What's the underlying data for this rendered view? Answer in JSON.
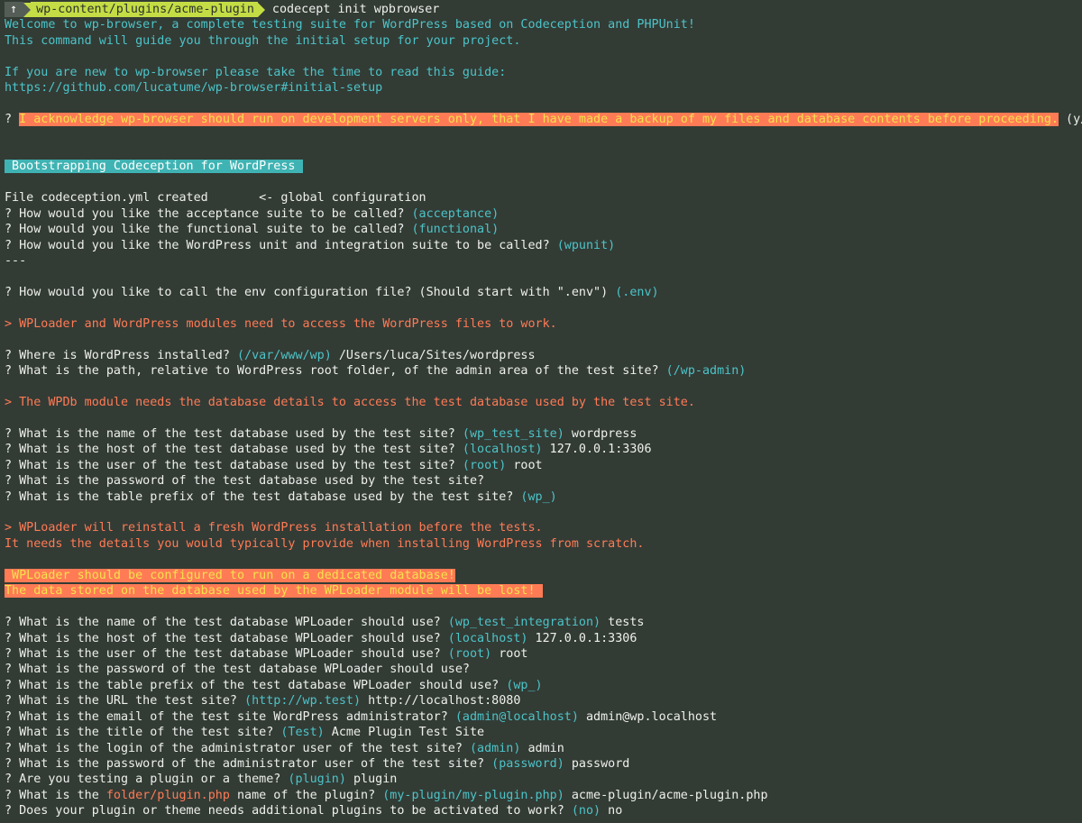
{
  "prompt": {
    "icon": "↑",
    "icon_name": "arrow-up-icon",
    "path": "wp-content/plugins/acme-plugin",
    "command": "codecept init wpbrowser"
  },
  "colors": {
    "background": "#333b35",
    "text": "#eef0ec",
    "cyan": "#4cc4c8",
    "orange": "#ff7b55",
    "highlight_text": "#f4e24b",
    "teal_badge": "#3fb3b3",
    "prompt_path": "#c4dd45"
  },
  "lines": [
    [
      [
        "Welcome to wp-browser, a complete testing suite for WordPress based on Codeception and PHPUnit!",
        "cyan"
      ]
    ],
    [
      [
        "This command will guide you through the initial setup for your project.",
        "cyan"
      ]
    ],
    [],
    [
      [
        "If you are new to wp-browser please take the time to read this guide:",
        "cyan"
      ]
    ],
    [
      [
        "https://github.com/lucatume/wp-browser#initial-setup",
        "cyan"
      ]
    ],
    [],
    [
      [
        "? ",
        "white"
      ],
      [
        "I acknowledge wp-browser should run on development servers only, that I have made a backup of my files and database contents before proceeding.",
        "hl-orange"
      ],
      [
        " (y/n) y",
        "white"
      ]
    ],
    [],
    [],
    [
      [
        " Bootstrapping Codeception for WordPress ",
        "hl-teal"
      ]
    ],
    [],
    [
      [
        "File codeception.yml created       <- global configuration",
        "white"
      ]
    ],
    [
      [
        "? How would you like the acceptance suite to be called? ",
        "white"
      ],
      [
        "(acceptance)",
        "cyan"
      ]
    ],
    [
      [
        "? How would you like the functional suite to be called? ",
        "white"
      ],
      [
        "(functional)",
        "cyan"
      ]
    ],
    [
      [
        "? How would you like the WordPress unit and integration suite to be called? ",
        "white"
      ],
      [
        "(wpunit)",
        "cyan"
      ]
    ],
    [
      [
        "---",
        "white"
      ]
    ],
    [],
    [
      [
        "? How would you like to call the env configuration file? (Should start with \".env\") ",
        "white"
      ],
      [
        "(.env)",
        "cyan"
      ]
    ],
    [],
    [
      [
        "> WPLoader and WordPress modules need to access the WordPress files to work.",
        "orange"
      ]
    ],
    [],
    [
      [
        "? Where is WordPress installed? ",
        "white"
      ],
      [
        "(/var/www/wp)",
        "cyan"
      ],
      [
        " /Users/luca/Sites/wordpress",
        "white"
      ]
    ],
    [
      [
        "? What is the path, relative to WordPress root folder, of the admin area of the test site? ",
        "white"
      ],
      [
        "(/wp-admin)",
        "cyan"
      ]
    ],
    [],
    [
      [
        "> The WPDb module needs the database details to access the test database used by the test site.",
        "orange"
      ]
    ],
    [],
    [
      [
        "? What is the name of the test database used by the test site? ",
        "white"
      ],
      [
        "(wp_test_site)",
        "cyan"
      ],
      [
        " wordpress",
        "white"
      ]
    ],
    [
      [
        "? What is the host of the test database used by the test site? ",
        "white"
      ],
      [
        "(localhost)",
        "cyan"
      ],
      [
        " 127.0.0.1:3306",
        "white"
      ]
    ],
    [
      [
        "? What is the user of the test database used by the test site? ",
        "white"
      ],
      [
        "(root)",
        "cyan"
      ],
      [
        " root",
        "white"
      ]
    ],
    [
      [
        "? What is the password of the test database used by the test site?",
        "white"
      ]
    ],
    [
      [
        "? What is the table prefix of the test database used by the test site? ",
        "white"
      ],
      [
        "(wp_)",
        "cyan"
      ]
    ],
    [],
    [
      [
        "> WPLoader will reinstall a fresh WordPress installation before the tests.",
        "orange"
      ]
    ],
    [
      [
        "It needs the details you would typically provide when installing WordPress from scratch.",
        "orange"
      ]
    ],
    [],
    [
      [
        " WPLoader should be configured to run on a dedicated database!",
        "hl-orange"
      ]
    ],
    [
      [
        "The data stored on the database used by the WPLoader module will be lost! ",
        "hl-orange"
      ]
    ],
    [],
    [
      [
        "? What is the name of the test database WPLoader should use? ",
        "white"
      ],
      [
        "(wp_test_integration)",
        "cyan"
      ],
      [
        " tests",
        "white"
      ]
    ],
    [
      [
        "? What is the host of the test database WPLoader should use? ",
        "white"
      ],
      [
        "(localhost)",
        "cyan"
      ],
      [
        " 127.0.0.1:3306",
        "white"
      ]
    ],
    [
      [
        "? What is the user of the test database WPLoader should use? ",
        "white"
      ],
      [
        "(root)",
        "cyan"
      ],
      [
        " root",
        "white"
      ]
    ],
    [
      [
        "? What is the password of the test database WPLoader should use?",
        "white"
      ]
    ],
    [
      [
        "? What is the table prefix of the test database WPLoader should use? ",
        "white"
      ],
      [
        "(wp_)",
        "cyan"
      ]
    ],
    [
      [
        "? What is the URL the test site? ",
        "white"
      ],
      [
        "(http://wp.test)",
        "cyan"
      ],
      [
        " http://localhost:8080",
        "white"
      ]
    ],
    [
      [
        "? What is the email of the test site WordPress administrator? ",
        "white"
      ],
      [
        "(admin@localhost)",
        "cyan"
      ],
      [
        " admin@wp.localhost",
        "white"
      ]
    ],
    [
      [
        "? What is the title of the test site? ",
        "white"
      ],
      [
        "(Test)",
        "cyan"
      ],
      [
        " Acme Plugin Test Site",
        "white"
      ]
    ],
    [
      [
        "? What is the login of the administrator user of the test site? ",
        "white"
      ],
      [
        "(admin)",
        "cyan"
      ],
      [
        " admin",
        "white"
      ]
    ],
    [
      [
        "? What is the password of the administrator user of the test site? ",
        "white"
      ],
      [
        "(password)",
        "cyan"
      ],
      [
        " password",
        "white"
      ]
    ],
    [
      [
        "? Are you testing a plugin or a theme? ",
        "white"
      ],
      [
        "(plugin)",
        "cyan"
      ],
      [
        " plugin",
        "white"
      ]
    ],
    [
      [
        "? What is the ",
        "white"
      ],
      [
        "folder/plugin.php",
        "orange"
      ],
      [
        " name of the plugin? ",
        "white"
      ],
      [
        "(my-plugin/my-plugin.php)",
        "cyan"
      ],
      [
        " acme-plugin/acme-plugin.php",
        "white"
      ]
    ],
    [
      [
        "? Does your plugin or theme needs additional plugins to be activated to work? ",
        "white"
      ],
      [
        "(no)",
        "cyan"
      ],
      [
        " no",
        "white"
      ]
    ]
  ]
}
